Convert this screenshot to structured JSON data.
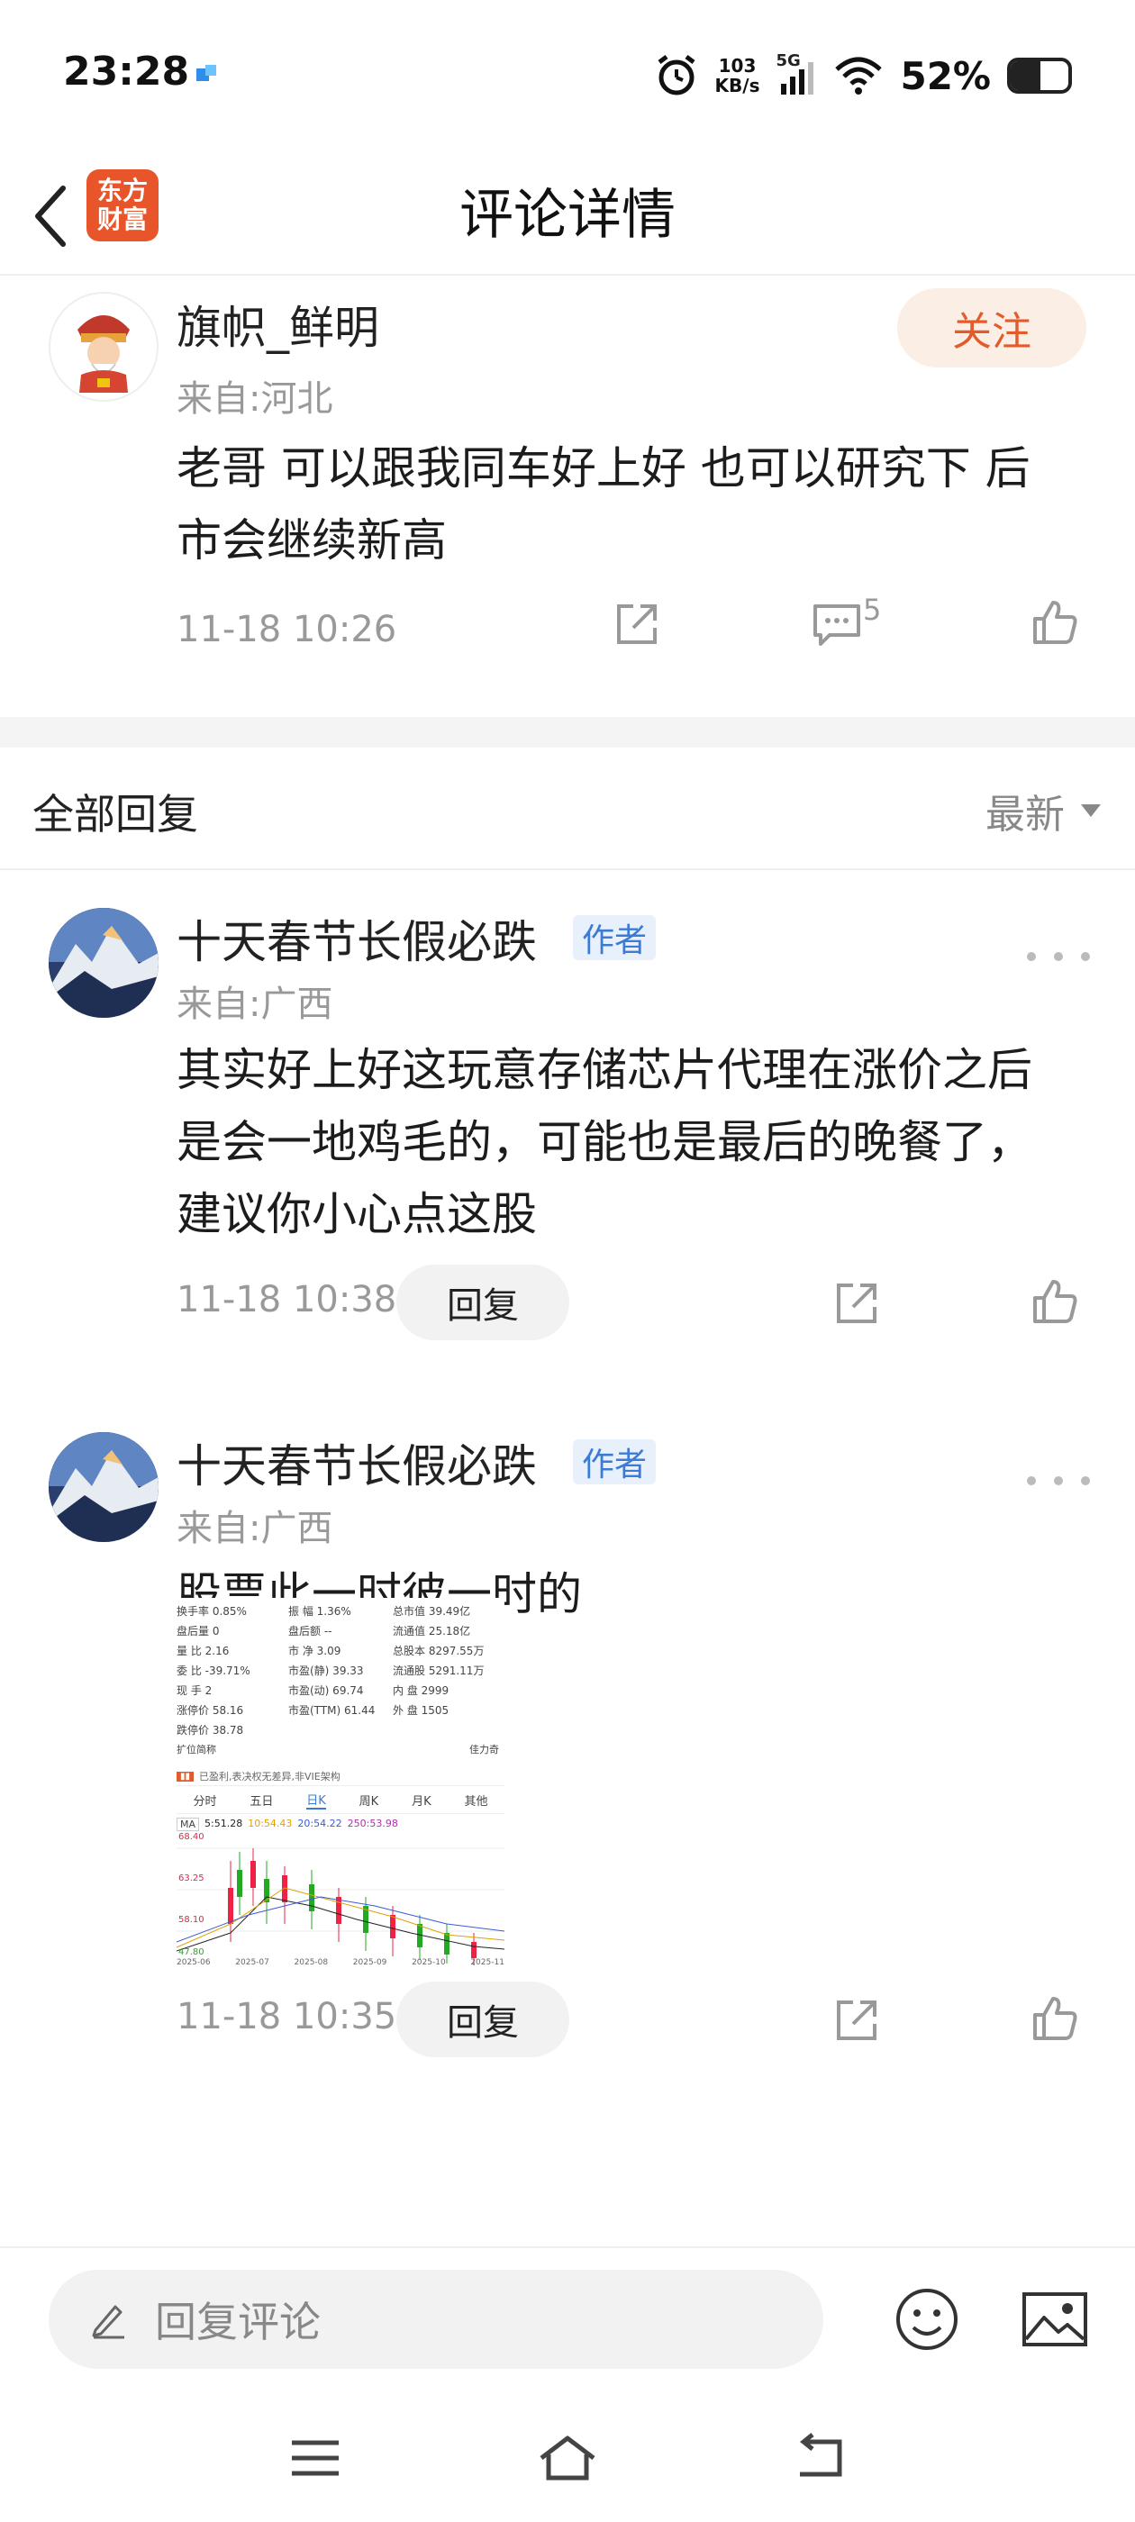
{
  "status_bar": {
    "time": "23:28",
    "net_speed_value": "103",
    "net_speed_unit": "KB/s",
    "signal": "5G",
    "battery_percent": "52%",
    "battery_level": 0.52
  },
  "header": {
    "title": "评论详情",
    "logo_line1": "东方",
    "logo_line2": "财富"
  },
  "original_comment": {
    "user": "旗帜_鲜明",
    "from": "来自:河北",
    "follow_label": "关注",
    "text_line1": "老哥 可以跟我同车好上好  也可以研究下 后",
    "text_line2": "市会继续新高",
    "time": "11-18 10:26",
    "reply_count": "5"
  },
  "replies_header": {
    "title": "全部回复",
    "sort_label": "最新"
  },
  "replies": [
    {
      "user": "十天春节长假必跌",
      "badge": "作者",
      "from": "来自:广西",
      "text_line1": "其实好上好这玩意存储芯片代理在涨价之后",
      "text_line2": "是会一地鸡毛的，可能也是最后的晚餐了，",
      "text_line3": "建议你小心点这股",
      "time": "11-18 10:38",
      "reply_label": "回复"
    },
    {
      "user": "十天春节长假必跌",
      "badge": "作者",
      "from": "来自:广西",
      "text_line1": "股票此一时彼一时的",
      "time": "11-18 10:35",
      "reply_label": "回复"
    }
  ],
  "stock_image": {
    "stats": [
      "换手率 0.85%",
      "振  幅 1.36%",
      "总市值 39.49亿",
      "盘后量 0",
      "盘后额 --",
      "流通值 25.18亿",
      "量  比 2.16",
      "市  净 3.09",
      "总股本 8297.55万",
      "委  比 -39.71%",
      "市盈(静) 39.33",
      "流通股 5291.11万",
      "现  手 2",
      "市盈(动) 69.74",
      "内  盘 2999",
      "涨停价 58.16",
      "市盈(TTM) 61.44",
      "外  盘 1505",
      "跌停价 38.78",
      "",
      ""
    ],
    "expand_label": "扩位简称",
    "note": "已盈利,表决权无差异,非VIE架构",
    "tabs": [
      "分时",
      "五日",
      "日K",
      "周K",
      "月K",
      "其他"
    ],
    "active_tab": "日K",
    "ma_label": "MA",
    "ma5": "5:51.28",
    "ma10": "10:54.43",
    "ma20": "20:54.22",
    "ma250": "250:53.98",
    "price_high": "68.40",
    "price_mid1": "63.25",
    "price_mid2": "58.10",
    "price_low": "47.80",
    "dates": [
      "2025-06",
      "2025-07",
      "2025-08",
      "2025-09",
      "2025-10",
      "2025-11"
    ],
    "brand": "佳力奇"
  },
  "bottom_bar": {
    "input_placeholder": "回复评论"
  },
  "colors": {
    "accent": "#e45b2b",
    "badge_blue": "#3b7bd6",
    "follow_bg": "#fbeee4"
  }
}
